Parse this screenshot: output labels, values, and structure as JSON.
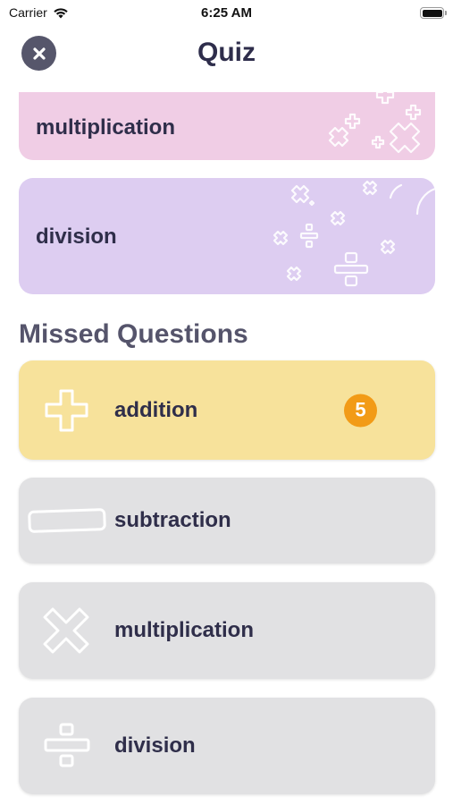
{
  "status_bar": {
    "carrier": "Carrier",
    "time": "6:25 AM"
  },
  "nav": {
    "title": "Quiz",
    "close_icon": "close-icon"
  },
  "operations": [
    {
      "label": "multiplication",
      "color": "#f0cde5"
    },
    {
      "label": "division",
      "color": "#ddcdf1"
    }
  ],
  "missed": {
    "title": "Missed Questions",
    "items": [
      {
        "label": "addition",
        "icon": "plus-icon",
        "count": "5",
        "color": "#f7e29b"
      },
      {
        "label": "subtraction",
        "icon": "minus-icon",
        "color": "#e1e1e3"
      },
      {
        "label": "multiplication",
        "icon": "times-icon",
        "color": "#e1e1e3"
      },
      {
        "label": "division",
        "icon": "divide-icon",
        "color": "#e1e1e3"
      }
    ]
  },
  "colors": {
    "badge": "#f29b17",
    "title_text": "#2e2d4b",
    "section_text": "#55546b",
    "close_button": "#56566b"
  }
}
